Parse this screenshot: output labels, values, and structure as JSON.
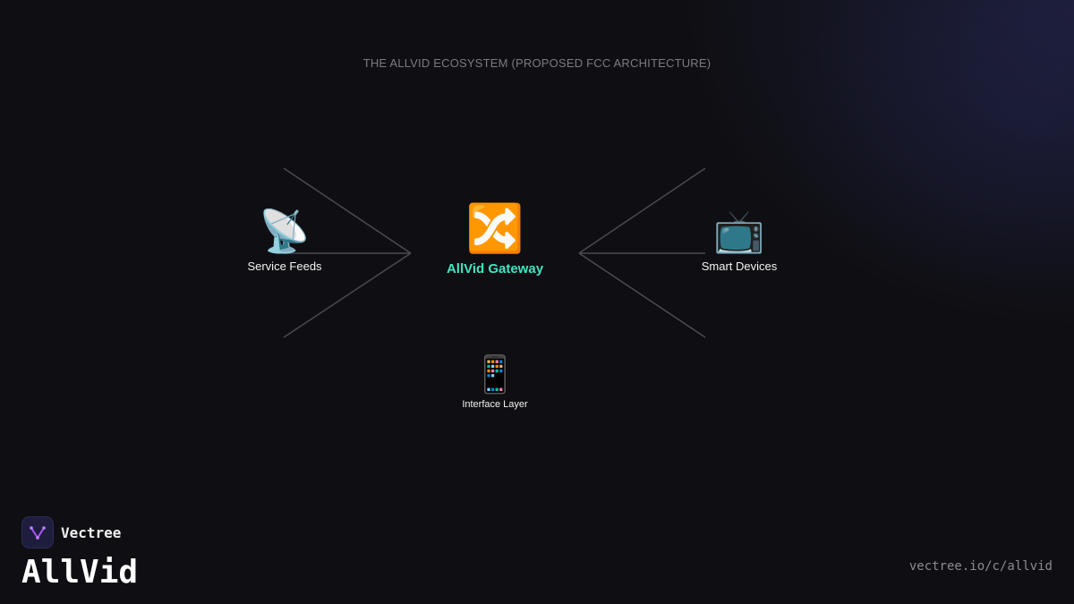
{
  "diagram": {
    "title": "THE ALLVID ECOSYSTEM (PROPOSED FCC ARCHITECTURE)",
    "nodes": {
      "feeds": {
        "icon": "satellite-dish-icon",
        "glyph": "📡",
        "label": "Service Feeds"
      },
      "gateway": {
        "icon": "shuffle-arrows-icon",
        "glyph": "🔀",
        "label": "AllVid Gateway"
      },
      "devices": {
        "icon": "television-icon",
        "glyph": "📺",
        "label": "Smart Devices"
      },
      "interface": {
        "icon": "mobile-phone-icon",
        "glyph": "📱",
        "label": "Interface Layer"
      }
    }
  },
  "branding": {
    "logo_icon": "vectree-logo-icon",
    "brand_name": "Vectree",
    "product_name": "AllVid",
    "url": "vectree.io/c/allvid"
  },
  "colors": {
    "background": "#0f0f13",
    "accent": "#3ee6c1",
    "connector": "#4a4a52",
    "logo_purple": "#a855f7"
  }
}
